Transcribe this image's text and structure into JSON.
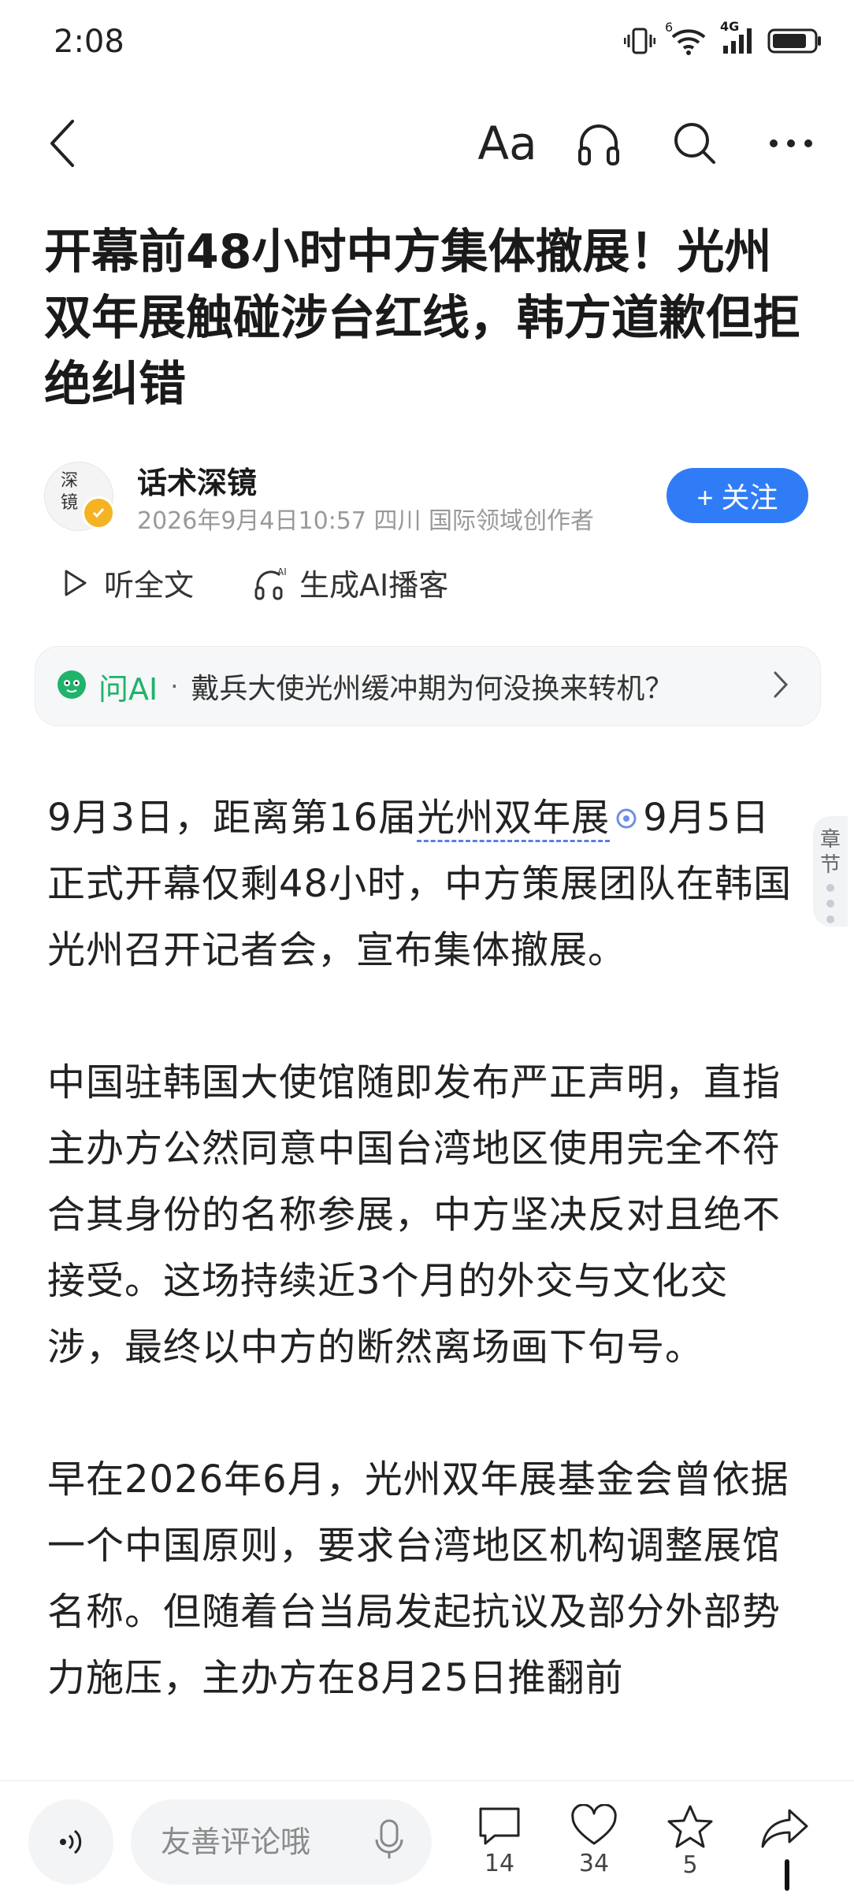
{
  "status_bar": {
    "time": "2:08",
    "net_label": "4G",
    "sim_label": "6"
  },
  "nav": {
    "font_label": "Aa"
  },
  "article": {
    "title": "开幕前48小时中方集体撤展！光州双年展触碰涉台红线，韩方道歉但拒绝纠错",
    "author": {
      "name": "话术深镜",
      "avatar_text": "深镜",
      "meta": "2026年9月4日10:57 四川 国际领域创作者",
      "follow_label": "+ 关注"
    },
    "actions": {
      "listen_label": "听全文",
      "podcast_label": "生成AI播客"
    },
    "ask_ai": {
      "label": "问AI",
      "separator": "·",
      "question": "戴兵大使光州缓冲期为何没换来转机？"
    },
    "paragraphs": [
      {
        "pre": "9月3日，距离第16届",
        "link": "光州双年展",
        "post": "9月5日正式开幕仅剩48小时，中方策展团队在韩国光州召开记者会，宣布集体撤展。"
      },
      {
        "text": "中国驻韩国大使馆随即发布严正声明，直指主办方公然同意中国台湾地区使用完全不符合其身份的名称参展，中方坚决反对且绝不接受。这场持续近3个月的外交与文化交涉，最终以中方的断然离场画下句号。"
      },
      {
        "text": "早在2026年6月，光州双年展基金会曾依据一个中国原则，要求台湾地区机构调整展馆名称。但随着台当局发起抗议及部分外部势力施压，主办方在8月25日推翻前"
      }
    ]
  },
  "chapter_tab": {
    "label": "章节"
  },
  "bottom_bar": {
    "comment_placeholder": "友善评论哦",
    "comments_count": "14",
    "likes_count": "34",
    "favorites_count": "5"
  }
}
